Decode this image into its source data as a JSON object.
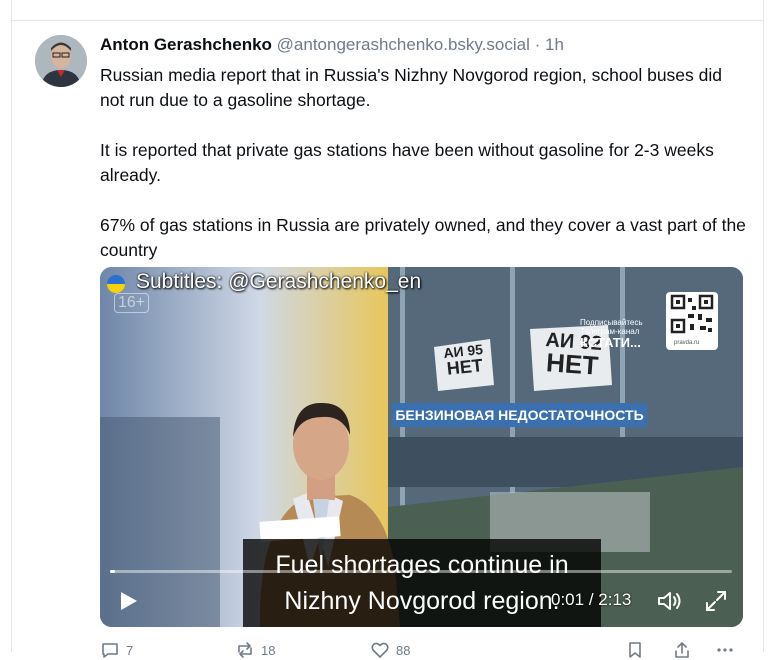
{
  "post": {
    "author_name": "Anton Gerashchenko",
    "author_handle": "@antongerashchenko.bsky.social",
    "separator": "·",
    "time": "1h",
    "paragraphs": [
      "Russian media report that in Russia's Nizhny Novgorod region, school buses did not run due to a gasoline shortage.",
      "It is reported that private gas stations have been without gasoline for 2-3 weeks already.",
      "67% of gas stations in Russia are privately owned, and they cover a vast part of the country"
    ]
  },
  "video": {
    "subtitle_credit": "Subtitles: @Gerashchenko_en",
    "age_rating": "16+",
    "sign_left": [
      "АИ 95",
      "НЕТ"
    ],
    "sign_right": [
      "АИ 92",
      "НЕТ"
    ],
    "banner": "БЕНЗИНОВАЯ НЕДОСТАТОЧНОСТЬ",
    "promo_small": [
      "Подписывайтесь",
      "Телеграм-канал"
    ],
    "promo_big": "КСТАТИ...",
    "qr_label": "pravda.ru",
    "caption_lines": [
      "Fuel shortages continue in",
      "Nizhny Novgorod region."
    ],
    "current_time": "0:01",
    "time_separator": "/",
    "duration": "2:13",
    "progress_fraction": 0.008
  },
  "actions": {
    "replies": "7",
    "reposts": "18",
    "likes": "88"
  },
  "colors": {
    "text": "#0b0f14",
    "muted": "#6f7b89",
    "divider": "#e3e8ee",
    "banner": "#3a6fb0"
  },
  "icons": [
    "reply-icon",
    "repost-icon",
    "like-icon",
    "bookmark-icon",
    "share-icon",
    "more-icon",
    "play-icon",
    "volume-icon",
    "fullscreen-icon"
  ]
}
